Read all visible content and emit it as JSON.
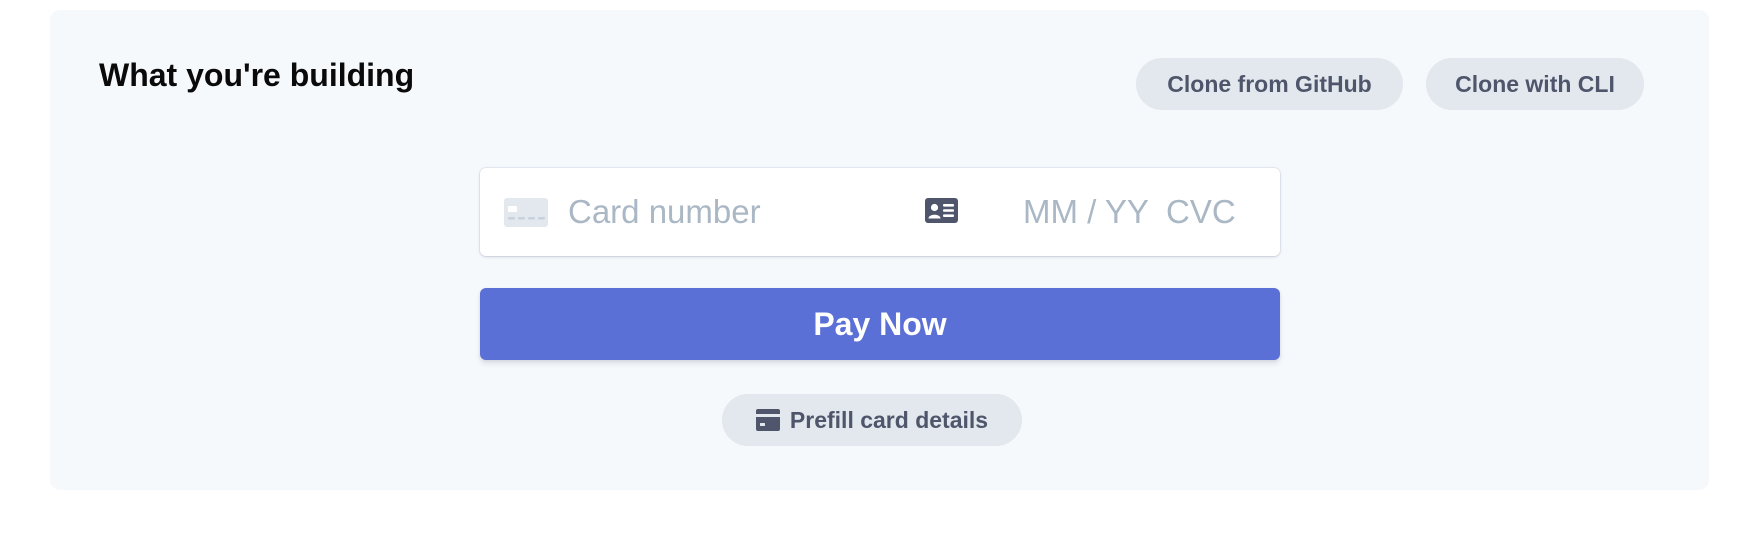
{
  "header": {
    "title": "What you're building",
    "clone_github_label": "Clone from GitHub",
    "clone_cli_label": "Clone with CLI"
  },
  "card_element": {
    "brand_icon": "credit-card-icon",
    "card_number_value": "",
    "card_number_placeholder": "Card number",
    "autofill_icon": "contact-card-icon",
    "expiry_value": "",
    "expiry_placeholder": "MM / YY",
    "cvc_value": "",
    "cvc_placeholder": "CVC"
  },
  "pay_button": {
    "label": "Pay Now"
  },
  "prefill_button": {
    "icon": "credit-card-icon",
    "label": "Prefill card details"
  },
  "colors": {
    "panel_background": "#f6f9fc",
    "accent": "#5a70d6",
    "pill_background": "#e3e8ee",
    "pill_text": "#4f566b",
    "placeholder": "#aab7c4"
  }
}
